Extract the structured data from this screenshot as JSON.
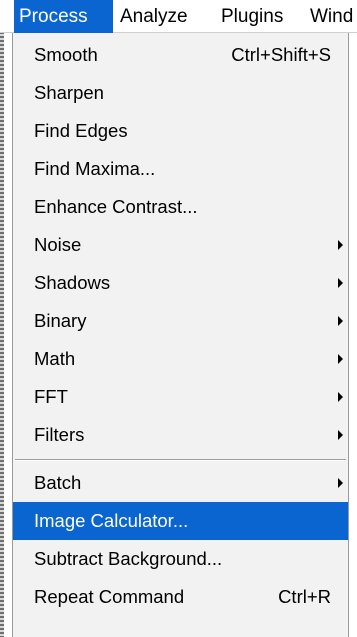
{
  "menubar": {
    "items": [
      {
        "label": "Process",
        "active": true
      },
      {
        "label": "Analyze",
        "active": false
      },
      {
        "label": "Plugins",
        "active": false
      },
      {
        "label": "Wind",
        "active": false
      }
    ]
  },
  "menu": {
    "items": [
      {
        "label": "Smooth",
        "shortcut": "Ctrl+Shift+S"
      },
      {
        "label": "Sharpen"
      },
      {
        "label": "Find Edges"
      },
      {
        "label": "Find Maxima..."
      },
      {
        "label": "Enhance Contrast..."
      },
      {
        "label": "Noise",
        "submenu": true
      },
      {
        "label": "Shadows",
        "submenu": true
      },
      {
        "label": "Binary",
        "submenu": true
      },
      {
        "label": "Math",
        "submenu": true
      },
      {
        "label": "FFT",
        "submenu": true
      },
      {
        "label": "Filters",
        "submenu": true
      },
      {
        "label": "Batch",
        "submenu": true
      },
      {
        "label": "Image Calculator...",
        "highlighted": true
      },
      {
        "label": "Subtract Background..."
      },
      {
        "label": "Repeat Command",
        "shortcut": "Ctrl+R"
      }
    ]
  },
  "colors": {
    "highlight": "#0a65d1",
    "menu_background": "#f2f2f2",
    "menubar_background": "#ffffff"
  }
}
